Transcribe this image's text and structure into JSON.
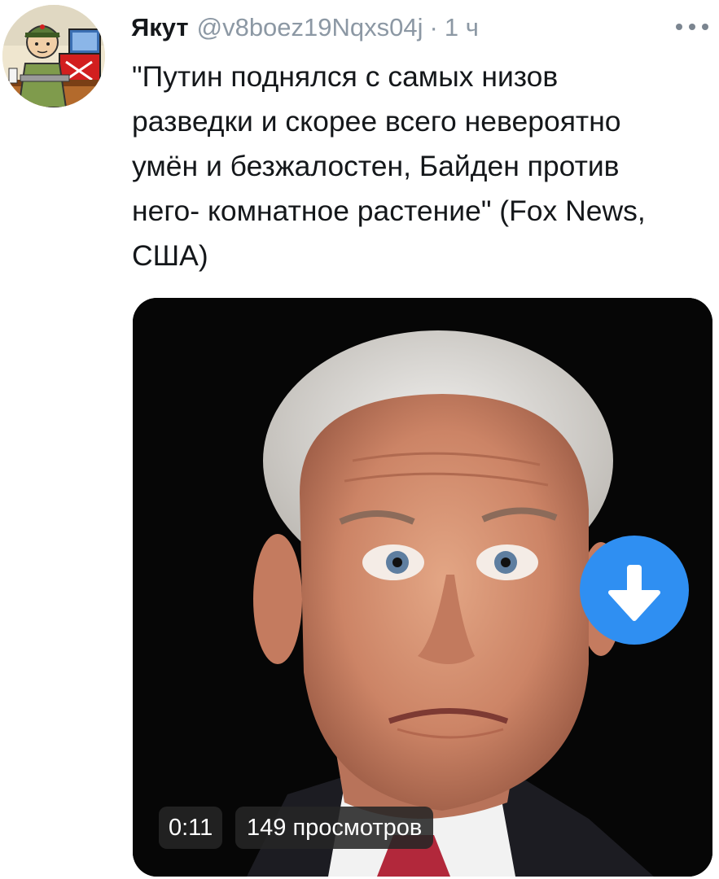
{
  "tweet": {
    "author": {
      "display_name": "Якут",
      "handle": "@v8boez19Nqxs04j",
      "avatar": "cartoon-avatar-icon"
    },
    "separator": "·",
    "time": "1 ч",
    "more_icon": "more-horizontal-icon",
    "text": "\"Путин поднялся с самых низов\nразведки и скорее всего невероятно\nумён и безжалостен, Байден против\nнего- комнатное растение\" (Fox News,\nСША)"
  },
  "media": {
    "type": "video",
    "duration": "0:11",
    "views": "149 просмотров",
    "download_icon": "download-arrow-icon"
  },
  "colors": {
    "accent": "#2f8ff2",
    "secondary_text": "#8c98a4",
    "primary_text": "#14171a",
    "overlay_pill": "#262626"
  }
}
